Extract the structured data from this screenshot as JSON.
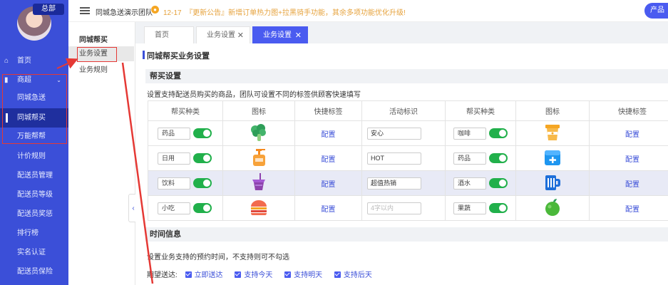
{
  "sidebar": {
    "badge": "总部",
    "items": [
      {
        "label": "首页",
        "icon": "home-icon",
        "glyph": "⌂"
      },
      {
        "label": "商超",
        "icon": "store-icon",
        "glyph": "▮",
        "caret": "⌄"
      },
      {
        "label": "同城急送"
      },
      {
        "label": "同城帮买"
      },
      {
        "label": "万能帮帮"
      },
      {
        "label": "计价规则"
      },
      {
        "label": "配送员管理"
      },
      {
        "label": "配送员等级"
      },
      {
        "label": "配送员奖惩"
      },
      {
        "label": "排行榜"
      },
      {
        "label": "实名认证"
      },
      {
        "label": "配送员保险"
      }
    ]
  },
  "topbar": {
    "team": "同城急送演示团队",
    "notice_date": "12-17",
    "notice_text": "『更新公告』新增订单热力图+拉黑骑手功能，其余多项功能优化升级!",
    "product_button": "产品"
  },
  "subnav": {
    "title": "同城帮买",
    "items": [
      "业务设置",
      "业务规则"
    ]
  },
  "tabs": [
    {
      "label": "首页",
      "closable": false
    },
    {
      "label": "业务设置",
      "closable": true,
      "close_glyph": "✕"
    },
    {
      "label": "业务设置",
      "closable": true,
      "close_glyph": "✕"
    }
  ],
  "page": {
    "title": "同城帮买业务设置",
    "section1": {
      "title": "帮买设置",
      "desc": "设置支持配送员购买的商品，团队可设置不同的标签供顾客快速填写"
    },
    "table": {
      "headers": [
        "帮买种类",
        "图标",
        "快捷标签",
        "活动标识",
        "帮买种类",
        "图标",
        "快捷标签"
      ],
      "link_label": "配置",
      "rows": [
        {
          "left": {
            "kind": "药品",
            "icon": "broccoli-icon",
            "tag": "安心",
            "placeholder": false
          },
          "right": {
            "kind": "咖啡",
            "icon": "coffee-cup-icon"
          }
        },
        {
          "left": {
            "kind": "日用",
            "icon": "pump-bottle-icon",
            "tag": "HOT",
            "placeholder": false
          },
          "right": {
            "kind": "药品",
            "icon": "medicine-box-icon"
          }
        },
        {
          "left": {
            "kind": "饮料",
            "icon": "drink-cup-icon",
            "tag": "超值热销",
            "placeholder": false
          },
          "right": {
            "kind": "酒水",
            "icon": "beer-mug-icon"
          }
        },
        {
          "left": {
            "kind": "小吃",
            "icon": "burger-icon",
            "tag": "4字以内",
            "placeholder": true
          },
          "right": {
            "kind": "果蔬",
            "icon": "apple-icon"
          }
        }
      ]
    },
    "section2": {
      "title": "时间信息",
      "desc": "设置业务支持的预约时间，不支持则可不勾选",
      "checkbox_label": "期望送达:",
      "options": [
        "立即送达",
        "支持今天",
        "支持明天",
        "支持后天"
      ]
    }
  },
  "colors": {
    "sidebar_bg": "#3b4fd8",
    "sidebar_active": "#1f2f9e",
    "accent": "#4a5bf0",
    "toggle_on": "#21b04b",
    "annotation": "#e53935",
    "notice": "#e6a23c"
  }
}
